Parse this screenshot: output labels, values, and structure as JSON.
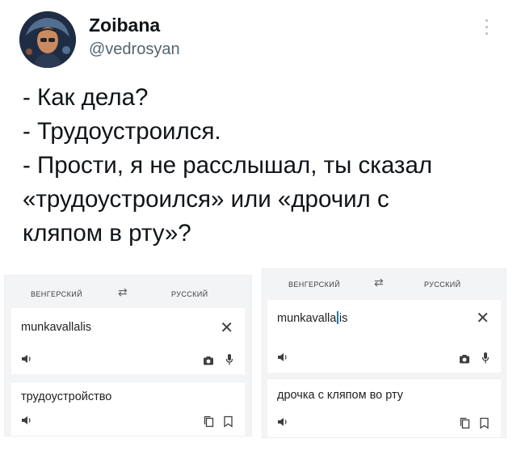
{
  "tweet": {
    "name": "Zoibana",
    "handle": "@vedrosyan",
    "lines": [
      "- Как дела?",
      "- Трудоустроился.",
      "- Прости, я не расслышал, ты сказал",
      "«трудоустроился» или «дрочил с",
      "кляпом в рту»?"
    ]
  },
  "translate_left": {
    "source_lang": "ВЕНГЕРСКИЙ",
    "target_lang": "РУССКИЙ",
    "swap_icon": "swap-arrows-icon",
    "input_text": "munkavallalis",
    "output_text": "трудоустройство"
  },
  "translate_right": {
    "source_lang": "ВЕНГЕРСКИЙ",
    "target_lang": "РУССКИЙ",
    "swap_icon": "swap-arrows-icon",
    "input_text_a": "munkavalla",
    "input_text_b": "is",
    "output_text": "дрочка с кляпом во рту"
  },
  "colors": {
    "handle": "#536471",
    "caret": "#1a73e8"
  }
}
